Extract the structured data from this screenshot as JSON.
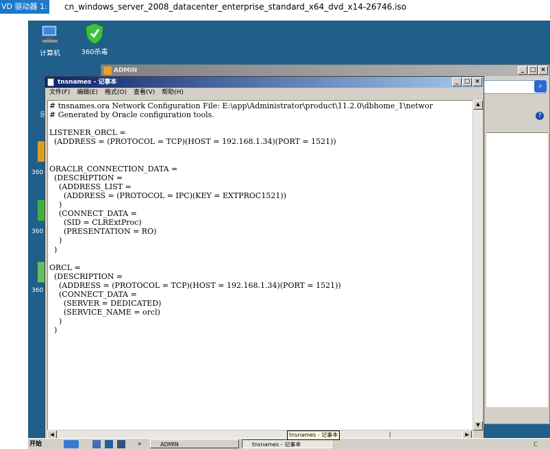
{
  "vm_bar": {
    "drive_label": "VD 驱动器 1:",
    "iso_name": "cn_windows_server_2008_datacenter_enterprise_standard_x64_dvd_x14-26746.iso"
  },
  "desktop_icons": [
    {
      "label": "计算机",
      "icon": "computer-icon"
    },
    {
      "label": "360杀毒",
      "icon": "shield-icon"
    }
  ],
  "desktop_partial_labels": [
    "回",
    "360",
    "360",
    "360"
  ],
  "admin_window": {
    "title": "ADMIN",
    "buttons": [
      "_",
      "□",
      "×"
    ]
  },
  "notepad": {
    "title": "tnsnames - 记事本",
    "menu": [
      "文件(F)",
      "编辑(E)",
      "格式(O)",
      "查看(V)",
      "帮助(H)"
    ],
    "content": "# tnsnames.ora Network Configuration File: E:\\app\\Administrator\\product\\11.2.0\\dbhome_1\\networ\n# Generated by Oracle configuration tools.\n\nLISTENER_ORCL =\n  (ADDRESS = (PROTOCOL = TCP)(HOST = 192.168.1.34)(PORT = 1521))\n\n\nORACLR_CONNECTION_DATA =\n  (DESCRIPTION =\n    (ADDRESS_LIST =\n      (ADDRESS = (PROTOCOL = IPC)(KEY = EXTPROC1521))\n    )\n    (CONNECT_DATA =\n      (SID = CLRExtProc)\n      (PRESENTATION = RO)\n    )\n  )\n\nORCL =\n  (DESCRIPTION =\n    (ADDRESS = (PROTOCOL = TCP)(HOST = 192.168.1.34)(PORT = 1521))\n    (CONNECT_DATA =\n      (SERVER = DEDICATED)\n      (SERVICE_NAME = orcl)\n    )\n  )"
  },
  "taskbar": {
    "start_label": "开始",
    "chevron": "»",
    "tasks": [
      "ADMIN",
      "tnsnames - 记事本"
    ],
    "tooltip": "tnsnames - 记事本",
    "tray_text": "C"
  },
  "colors": {
    "desktop": "#1f5f8a",
    "titlebar_active": "#0a246a",
    "vm_label_bg": "#1e78c8"
  }
}
